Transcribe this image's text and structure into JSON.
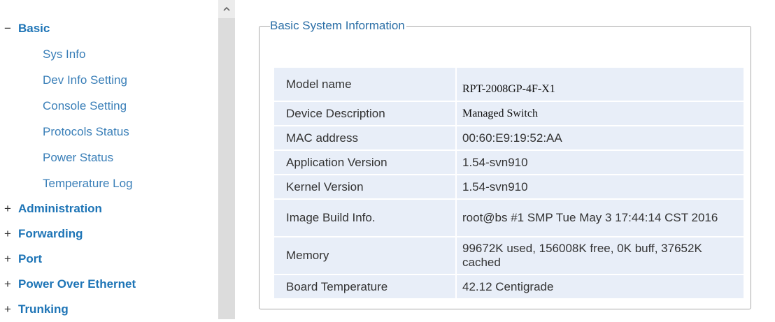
{
  "sidebar": {
    "groups": [
      {
        "sign": "−",
        "label": "Basic",
        "items": [
          "Sys Info",
          "Dev Info Setting",
          "Console Setting",
          "Protocols Status",
          "Power Status",
          "Temperature Log"
        ]
      },
      {
        "sign": "+",
        "label": "Administration"
      },
      {
        "sign": "+",
        "label": "Forwarding"
      },
      {
        "sign": "+",
        "label": "Port"
      },
      {
        "sign": "+",
        "label": "Power Over Ethernet"
      },
      {
        "sign": "+",
        "label": "Trunking"
      }
    ]
  },
  "main": {
    "panel_title": "Basic System Information",
    "rows": [
      {
        "label": "Model name",
        "value": "RPT-2008GP-4F-X1"
      },
      {
        "label": "Device Description",
        "value": "Managed Switch"
      },
      {
        "label": "MAC address",
        "value": "00:60:E9:19:52:AA"
      },
      {
        "label": "Application Version",
        "value": "1.54-svn910"
      },
      {
        "label": "Kernel Version",
        "value": "1.54-svn910"
      },
      {
        "label": "Image Build Info.",
        "value": "root@bs #1 SMP Tue May 3 17:44:14 CST 2016"
      },
      {
        "label": "Memory",
        "value": "99672K used, 156008K free, 0K buff, 37652K cached"
      },
      {
        "label": "Board Temperature",
        "value": "42.12 Centigrade"
      }
    ]
  }
}
